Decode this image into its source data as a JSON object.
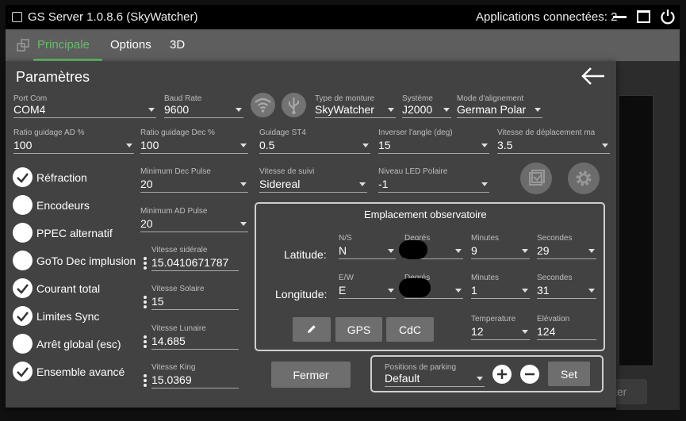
{
  "window": {
    "title": "GS Server 1.0.8.6 (SkyWatcher)",
    "apps_connected": "Applications connectées: 2"
  },
  "menu": {
    "items": [
      "Principale",
      "Options",
      "3D"
    ]
  },
  "background": {
    "button_text": "cter"
  },
  "dialog": {
    "title": "Paramètres",
    "row1": [
      {
        "label": "Port Com",
        "value": "COM4"
      },
      {
        "label": "Baud Rate",
        "value": "9600"
      },
      {
        "label": "Type de monture",
        "value": "SkyWatcher"
      },
      {
        "label": "Système",
        "value": "J2000"
      },
      {
        "label": "Mode d'alignement",
        "value": "German Polar"
      }
    ],
    "row2": [
      {
        "label": "Ratio guidage AD %",
        "value": "100"
      },
      {
        "label": "Ratio guidage Dec %",
        "value": "100"
      },
      {
        "label": "Guidage ST4",
        "value": "0.5"
      },
      {
        "label": "Inverser l'angle (deg)",
        "value": "15"
      },
      {
        "label": "Vitesse de déplacement ma",
        "value": "3.5"
      }
    ],
    "checkboxes": [
      {
        "label": "Réfraction",
        "checked": true
      },
      {
        "label": "Encodeurs",
        "checked": false
      },
      {
        "label": "PPEC alternatif",
        "checked": false
      },
      {
        "label": "GoTo Dec implusion",
        "checked": false
      },
      {
        "label": "Courant total",
        "checked": true
      },
      {
        "label": "Limites Sync",
        "checked": true
      },
      {
        "label": "Arrêt global (esc)",
        "checked": false
      },
      {
        "label": "Ensemble avancé",
        "checked": true
      }
    ],
    "min_dec_pulse": {
      "label": "Minimum Dec Pulse",
      "value": "20"
    },
    "min_ad_pulse": {
      "label": "Minimum AD Pulse",
      "value": "20"
    },
    "tracking": {
      "label": "Vitesse de suivi",
      "value": "Sidereal"
    },
    "led": {
      "label": "Niveau LED Polaire",
      "value": "-1"
    },
    "rates": [
      {
        "label": "Vitesse sidérale",
        "value": "15.0410671787"
      },
      {
        "label": "Vitesse Solaire",
        "value": "15"
      },
      {
        "label": "Vitesse Lunaire",
        "value": "14.685"
      },
      {
        "label": "Vitesse King",
        "value": "15.0369"
      }
    ],
    "observatory": {
      "title": "Emplacement observatoire",
      "latitude_label": "Latitude:",
      "longitude_label": "Longitude:",
      "ns": {
        "label": "N/S",
        "value": "N"
      },
      "ew": {
        "label": "E/W",
        "value": "E"
      },
      "degrees_label": "Degrés",
      "lat_minutes": {
        "label": "Minutes",
        "value": "9"
      },
      "lat_seconds": {
        "label": "Secondes",
        "value": "29"
      },
      "lon_minutes": {
        "label": "Minutes",
        "value": "1"
      },
      "lon_seconds": {
        "label": "Secondes",
        "value": "31"
      },
      "gps": "GPS",
      "cdc": "CdC",
      "temperature": {
        "label": "Temperature",
        "value": "12"
      },
      "elevation": {
        "label": "Elévation",
        "value": "124"
      }
    },
    "close": "Fermer",
    "parking": {
      "label": "Positions de parking",
      "value": "Default",
      "set": "Set"
    }
  },
  "icons": [
    "checkbox-icon",
    "minimize-icon",
    "maximize-icon",
    "power-icon",
    "window-icon",
    "back-arrow-icon",
    "wifi-icon",
    "usb-icon",
    "check-icon",
    "gear-icon",
    "pencil-icon",
    "plus-icon",
    "minus-icon",
    "drag-icon"
  ]
}
